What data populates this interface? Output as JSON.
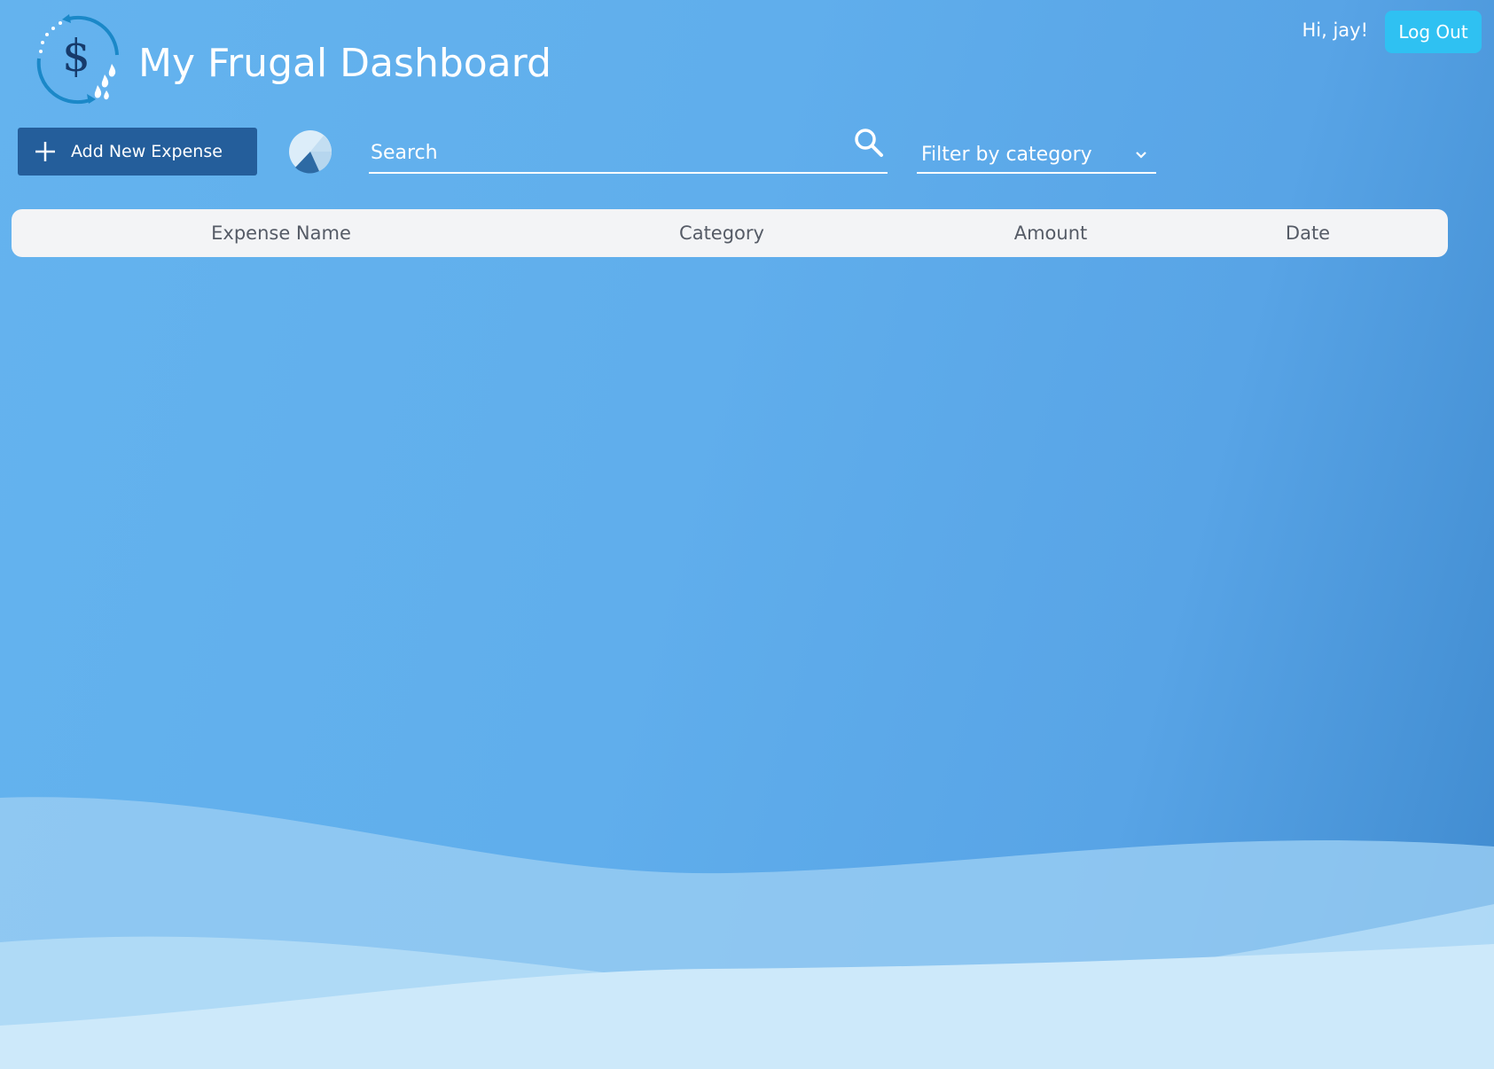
{
  "header": {
    "app_title": "My Frugal Dashboard",
    "greeting": "Hi, jay!",
    "logout_label": "Log Out",
    "logo_symbol": "$"
  },
  "toolbar": {
    "add_expense_label": "Add New Expense",
    "search_placeholder": "Search",
    "search_value": "",
    "filter_label": "Filter by category"
  },
  "table": {
    "columns": [
      "Expense Name",
      "Category",
      "Amount",
      "Date"
    ],
    "rows": []
  },
  "icons": {
    "logo": "dollar-cycle-logo-icon",
    "add": "plus-icon",
    "chart": "pie-chart-icon",
    "search": "search-icon",
    "filter": "chevron-down-icon"
  },
  "colors": {
    "background_start": "#64b3ee",
    "background_end": "#3f8acf",
    "add_button": "#245e9b",
    "logout_button": "#2fc1f2",
    "table_header_bg": "#f3f4f6",
    "table_header_text": "#555b66"
  }
}
